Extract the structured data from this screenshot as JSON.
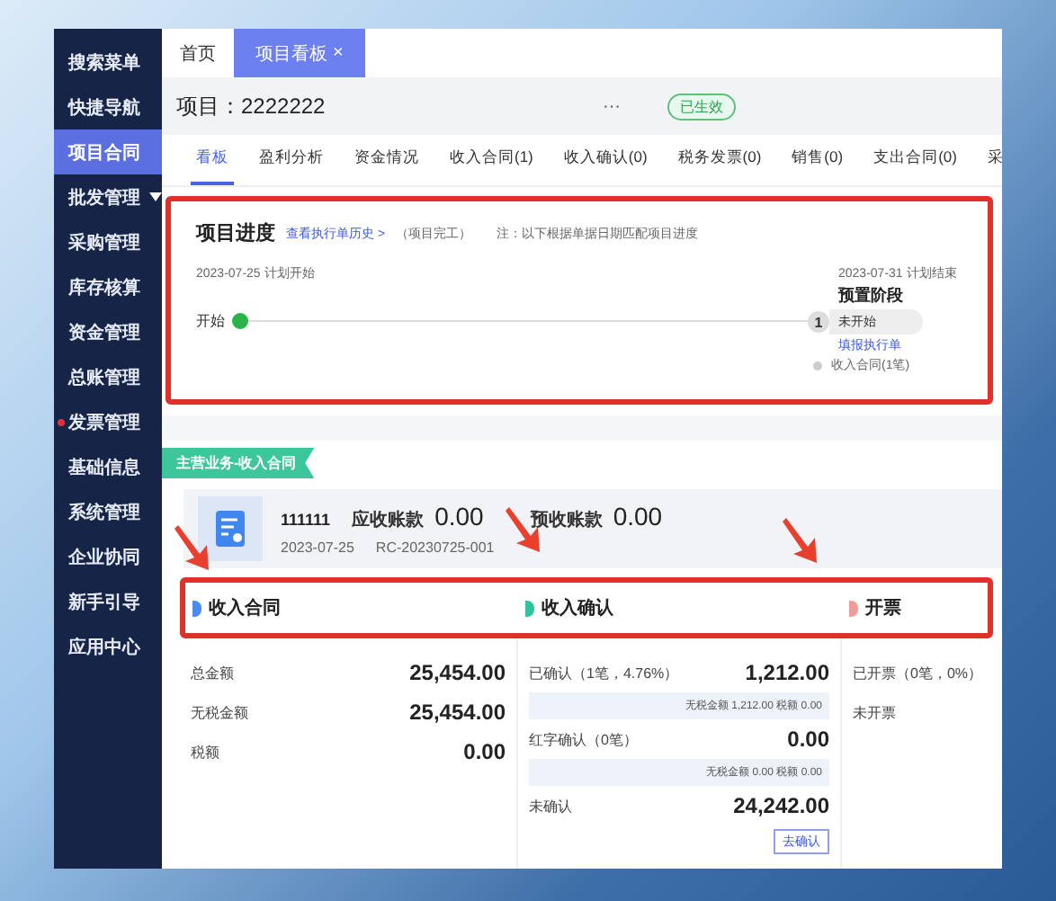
{
  "sidebar": {
    "items": [
      {
        "label": "搜索菜单",
        "selected": false,
        "kind": "item",
        "alert": false
      },
      {
        "label": "快捷导航",
        "selected": false,
        "kind": "item",
        "alert": false
      },
      {
        "label": "项目合同",
        "selected": true,
        "kind": "item",
        "alert": false
      },
      {
        "label": "批发管理",
        "selected": false,
        "kind": "group",
        "alert": false
      },
      {
        "label": "采购管理",
        "selected": false,
        "kind": "item",
        "alert": false
      },
      {
        "label": "库存核算",
        "selected": false,
        "kind": "item",
        "alert": false
      },
      {
        "label": "资金管理",
        "selected": false,
        "kind": "item",
        "alert": false
      },
      {
        "label": "总账管理",
        "selected": false,
        "kind": "item",
        "alert": false
      },
      {
        "label": "发票管理",
        "selected": false,
        "kind": "item",
        "alert": true
      },
      {
        "label": "基础信息",
        "selected": false,
        "kind": "item",
        "alert": false
      },
      {
        "label": "系统管理",
        "selected": false,
        "kind": "item",
        "alert": false
      },
      {
        "label": "企业协同",
        "selected": false,
        "kind": "item",
        "alert": false
      },
      {
        "label": "新手引导",
        "selected": false,
        "kind": "item",
        "alert": false
      },
      {
        "label": "应用中心",
        "selected": false,
        "kind": "item",
        "alert": false
      }
    ]
  },
  "page_tabs": [
    {
      "label": "首页",
      "selected": false
    },
    {
      "label": "项目看板",
      "selected": true,
      "close": "×"
    }
  ],
  "header": {
    "project": "项目：2222222",
    "more": "···",
    "status": "已生效"
  },
  "tabs": [
    {
      "label": "看板",
      "selected": true
    },
    {
      "label": "盈利分析",
      "selected": false
    },
    {
      "label": "资金情况",
      "selected": false
    },
    {
      "label": "收入合同(1)",
      "selected": false
    },
    {
      "label": "收入确认(0)",
      "selected": false
    },
    {
      "label": "税务发票(0)",
      "selected": false
    },
    {
      "label": "销售(0)",
      "selected": false
    },
    {
      "label": "支出合同(0)",
      "selected": false
    },
    {
      "label": "采",
      "selected": false
    }
  ],
  "progress": {
    "title": "项目进度",
    "history_link": "查看执行单历史 >",
    "status": "（项目完工）",
    "note": "注：以下根据单据日期匹配项目进度",
    "start_date": "2023-07-25 计划开始",
    "start_label": "开始",
    "stage": {
      "date": "2023-07-31 计划结束",
      "name": "预置阶段",
      "step": "1",
      "state": "未开始",
      "link": "填报执行单",
      "item": "收入合同(1笔)"
    }
  },
  "business": {
    "label": "主营业务-收入合同",
    "contract": {
      "code": "111111",
      "receivable_label": "应收账款",
      "receivable": "0.00",
      "advance_label": "预收账款",
      "advance": "0.00",
      "date": "2023-07-25",
      "number": "RC-20230725-001"
    },
    "sections": [
      {
        "title": "收入合同",
        "color": "#4a8af4",
        "rows": [
          {
            "label": "总金额",
            "value": "25,454.00"
          },
          {
            "label": "无税金额",
            "value": "25,454.00"
          },
          {
            "label": "税额",
            "value": "0.00"
          }
        ]
      },
      {
        "title": "收入确认",
        "color": "#2fc3a0",
        "rows": [
          {
            "label": "已确认（1笔，4.76%）",
            "value": "1,212.00",
            "detail": "无税金额 1,212.00 税额 0.00"
          },
          {
            "label": "红字确认（0笔）",
            "value": "0.00",
            "detail": "无税金额 0.00 税额 0.00"
          },
          {
            "label": "未确认",
            "value": "24,242.00",
            "action": "去确认"
          }
        ]
      },
      {
        "title": "开票",
        "color": "#f29b9b",
        "rows": [
          {
            "label": "已开票（0笔，0%）"
          },
          {
            "label": "未开票"
          }
        ]
      }
    ]
  }
}
